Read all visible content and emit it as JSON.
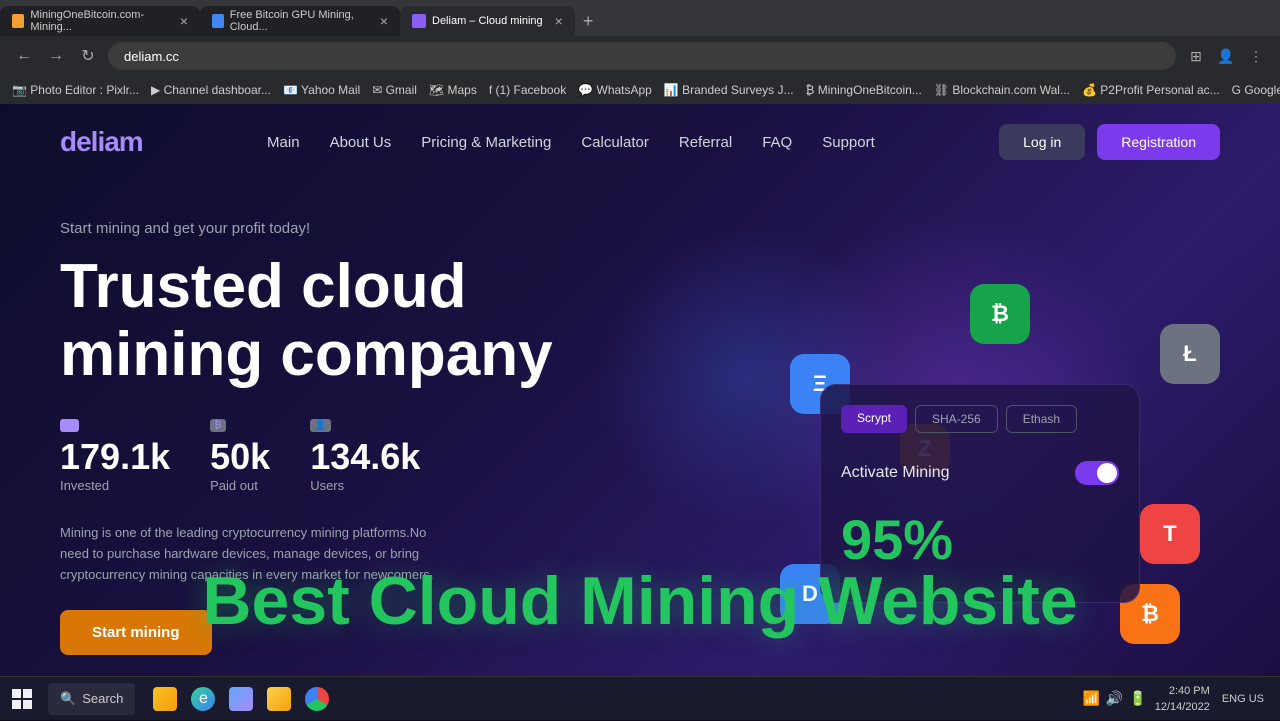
{
  "browser": {
    "tabs": [
      {
        "label": "MiningOneBitcoin.com-Mining...",
        "icon": "orange",
        "active": false,
        "id": "tab1"
      },
      {
        "label": "Free Bitcoin GPU Mining, Cloud...",
        "icon": "blue",
        "active": false,
        "id": "tab2"
      },
      {
        "label": "Deliam – Cloud mining",
        "icon": "purple",
        "active": true,
        "id": "tab3"
      }
    ],
    "address": "deliam.cc",
    "bookmarks": [
      "Photo Editor : Pixlr...",
      "Channel dashboar...",
      "Yahoo Mail",
      "Gmail",
      "Maps",
      "(1) Facebook",
      "WhatsApp",
      "Branded Surveys J...",
      "MiningOneBitcoin...",
      "Blockchain.com Wal...",
      "P2Profit Personal ac...",
      "Google AdSense"
    ]
  },
  "site": {
    "logo": "deliam",
    "nav": {
      "links": [
        "Main",
        "About Us",
        "Pricing & Marketing",
        "Calculator",
        "Referral",
        "FAQ",
        "Support"
      ]
    },
    "buttons": {
      "login": "Log in",
      "register": "Registration"
    },
    "hero": {
      "subtitle": "Start mining and get your profit today!",
      "title": "Trusted cloud mining company",
      "stats": [
        {
          "value": "179.1k",
          "label": "Invested",
          "icon": "₿"
        },
        {
          "value": "50k",
          "label": "Paid out",
          "icon": "₿"
        },
        {
          "value": "134.6k",
          "label": "Users",
          "icon": "👤"
        }
      ],
      "description": "Mining is one of the leading cryptocurrency mining platforms.No need to purchase hardware devices, manage devices, or bring cryptocurrency mining capacities in every market for newcomers.",
      "cta": "Start mining"
    },
    "mining_card": {
      "algo_tabs": [
        "Scrypt",
        "SHA-256",
        "Ethash"
      ],
      "active_tab": "Scrypt",
      "activate_label": "Activate Mining",
      "percentage": "95%"
    },
    "overlay_text": "Best Cloud Mining Website"
  },
  "taskbar": {
    "search_placeholder": "Search",
    "time": "2:40 PM",
    "date": "12/14/2022",
    "language": "ENG US"
  },
  "crypto_icons": [
    {
      "symbol": "Ξ",
      "color": "#3b82f6",
      "name": "ethereum"
    },
    {
      "symbol": "₿",
      "color": "#16a34a",
      "name": "bitcoin"
    },
    {
      "symbol": "Ł",
      "color": "#9ca3af",
      "name": "litecoin"
    },
    {
      "symbol": "Z",
      "color": "#d97706",
      "name": "zcash"
    },
    {
      "symbol": "T",
      "color": "#ef4444",
      "name": "tron"
    },
    {
      "symbol": "₿",
      "color": "#f97316",
      "name": "bitcoin2"
    },
    {
      "symbol": "D",
      "color": "#4f46e5",
      "name": "dogecoin"
    }
  ]
}
